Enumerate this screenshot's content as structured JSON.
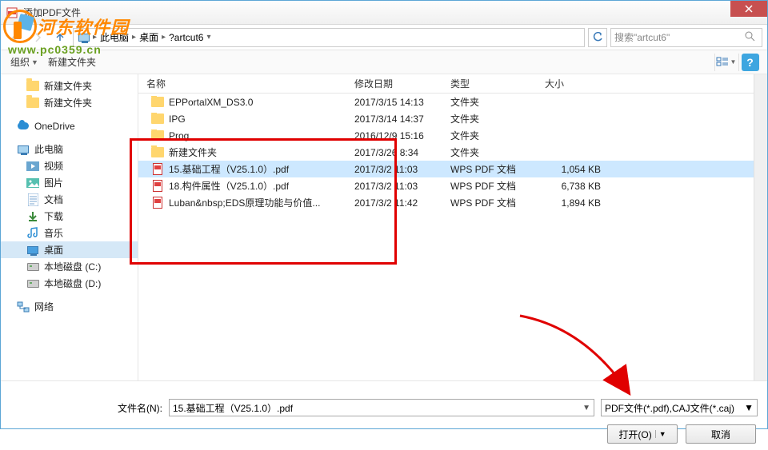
{
  "watermark": {
    "brand": "河东软件园",
    "url": "www.pc0359.cn"
  },
  "window": {
    "title": "添加PDF文件",
    "close_label": "✕"
  },
  "addressbar": {
    "segments": [
      "此电脑",
      "桌面",
      "?artcut6"
    ],
    "search_placeholder": "搜索\"artcut6\""
  },
  "toolbar": {
    "organize": "组织",
    "newfolder": "新建文件夹",
    "help": "?"
  },
  "sidebar": {
    "quick": [
      {
        "label": "新建文件夹",
        "icon": "folder"
      },
      {
        "label": "新建文件夹",
        "icon": "folder"
      }
    ],
    "onedrive": {
      "label": "OneDrive",
      "icon": "cloud"
    },
    "thispc": {
      "label": "此电脑",
      "children": [
        {
          "label": "视频",
          "icon": "video"
        },
        {
          "label": "图片",
          "icon": "image"
        },
        {
          "label": "文档",
          "icon": "doc"
        },
        {
          "label": "下载",
          "icon": "download"
        },
        {
          "label": "音乐",
          "icon": "music"
        },
        {
          "label": "桌面",
          "icon": "desktop",
          "selected": true
        },
        {
          "label": "本地磁盘 (C:)",
          "icon": "drive"
        },
        {
          "label": "本地磁盘 (D:)",
          "icon": "drive"
        }
      ]
    },
    "network": {
      "label": "网络",
      "icon": "network"
    }
  },
  "columns": {
    "name": "名称",
    "date": "修改日期",
    "type": "类型",
    "size": "大小"
  },
  "files": [
    {
      "name": "EPPortalXM_DS3.0",
      "date": "2017/3/15 14:13",
      "type": "文件夹",
      "size": "",
      "icon": "folder"
    },
    {
      "name": "IPG",
      "date": "2017/3/14 14:37",
      "type": "文件夹",
      "size": "",
      "icon": "folder"
    },
    {
      "name": "Prog",
      "date": "2016/12/9 15:16",
      "type": "文件夹",
      "size": "",
      "icon": "folder"
    },
    {
      "name": "新建文件夹",
      "date": "2017/3/26 8:34",
      "type": "文件夹",
      "size": "",
      "icon": "folder"
    },
    {
      "name": "15.基础工程（V25.1.0）.pdf",
      "date": "2017/3/2  11:03",
      "type": "WPS PDF 文档",
      "size": "1,054 KB",
      "icon": "pdf",
      "selected": true
    },
    {
      "name": "18.构件属性（V25.1.0）.pdf",
      "date": "2017/3/2  11:03",
      "type": "WPS PDF 文档",
      "size": "6,738 KB",
      "icon": "pdf"
    },
    {
      "name": "Luban&amp;nbsp;EDS原理功能与价值...",
      "date": "2017/3/2  11:42",
      "type": "WPS PDF 文档",
      "size": "1,894 KB",
      "icon": "pdf"
    }
  ],
  "bottom": {
    "filename_label": "文件名(N):",
    "filename_value": "15.基础工程（V25.1.0）.pdf",
    "filter": "PDF文件(*.pdf),CAJ文件(*.caj)",
    "open": "打开(O)",
    "cancel": "取消"
  }
}
